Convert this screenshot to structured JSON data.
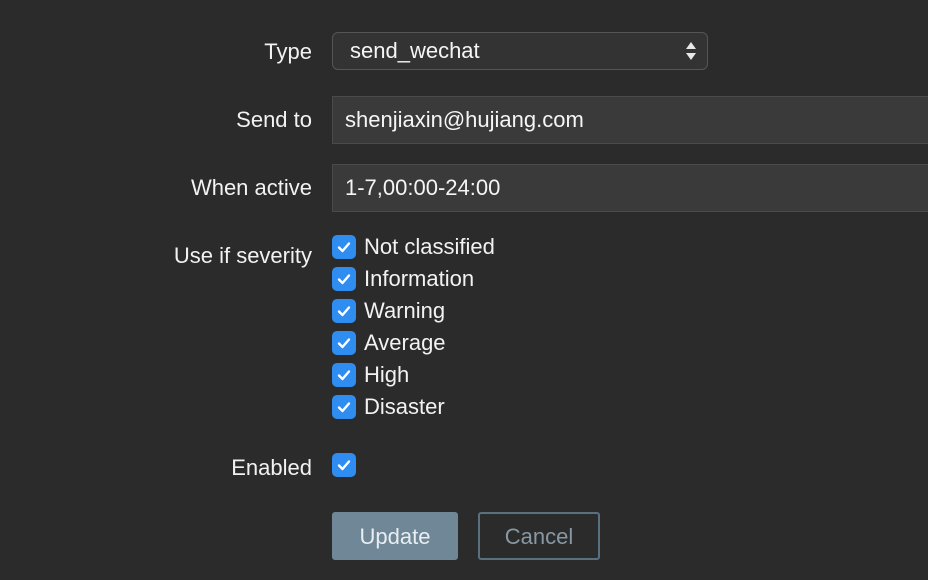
{
  "form": {
    "type": {
      "label": "Type",
      "value": "send_wechat"
    },
    "send_to": {
      "label": "Send to",
      "value": "shenjiaxin@hujiang.com"
    },
    "when_active": {
      "label": "When active",
      "value": "1-7,00:00-24:00"
    },
    "severity": {
      "label": "Use if severity",
      "options": [
        {
          "label": "Not classified",
          "checked": true
        },
        {
          "label": "Information",
          "checked": true
        },
        {
          "label": "Warning",
          "checked": true
        },
        {
          "label": "Average",
          "checked": true
        },
        {
          "label": "High",
          "checked": true
        },
        {
          "label": "Disaster",
          "checked": true
        }
      ]
    },
    "enabled": {
      "label": "Enabled",
      "checked": true
    },
    "buttons": {
      "update": "Update",
      "cancel": "Cancel"
    }
  },
  "colors": {
    "background": "#2b2b2b",
    "checkbox": "#2f8cf0",
    "update_button": "#6f8796",
    "cancel_border": "#587080"
  },
  "icons": {
    "select_arrows": "updown-arrows-icon",
    "checkmark": "checkmark-icon"
  }
}
